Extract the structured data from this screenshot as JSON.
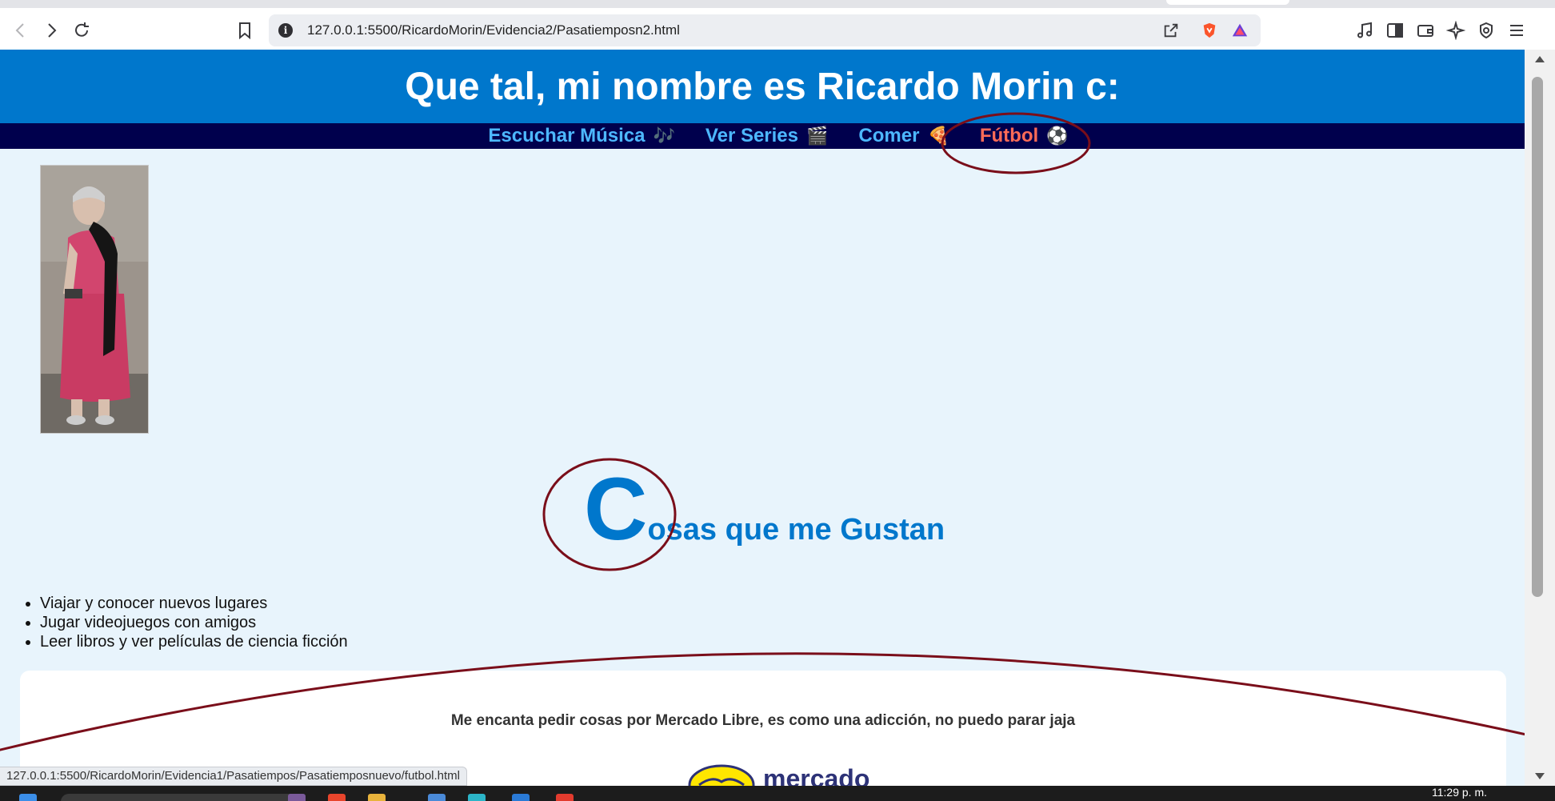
{
  "browser": {
    "url": "127.0.0.1:5500/RicardoMorin/Evidencia2/Pasatiemposn2.html",
    "status_url": "127.0.0.1:5500/RicardoMorin/Evidencia1/Pasatiempos/Pasatiemposnuevo/futbol.html"
  },
  "page": {
    "header_title": "Que tal, mi nombre es Ricardo Morin c:",
    "nav": [
      {
        "label": "Escuchar Música",
        "emoji": "🎶"
      },
      {
        "label": "Ver Series",
        "emoji": "🎬"
      },
      {
        "label": "Comer",
        "emoji": "🍕"
      },
      {
        "label": "Fútbol",
        "emoji": "⚽"
      }
    ],
    "section_title_first": "C",
    "section_title_rest": "osas que me Gustan",
    "likes": [
      "Viajar y conocer nuevos lugares",
      "Jugar videojuegos con amigos",
      "Leer libros y ver películas de ciencia ficción"
    ],
    "card_text": "Me encanta pedir cosas por Mercado Libre, es como una adicción, no puedo parar jaja",
    "card_logo_word": "mercado"
  },
  "taskbar": {
    "clock": "11:29 p. m."
  },
  "colors": {
    "header_bg": "#0077cc",
    "nav_bg": "#00004d",
    "nav_link": "#4db8ff",
    "nav_active": "#ff6b57",
    "page_bg": "#e8f4fc",
    "annotation": "#7a0e1a"
  }
}
